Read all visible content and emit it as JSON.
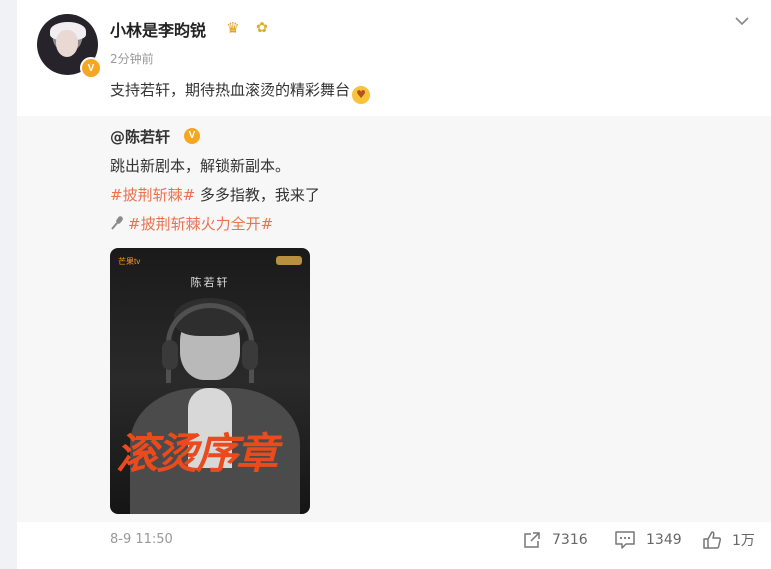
{
  "post": {
    "username": "小林是李昀锐",
    "time": "2分钟前",
    "text": "支持若轩，期待热血滚烫的精彩舞台",
    "emoji": "smiling-face-hearts"
  },
  "repost": {
    "author": "@陈若轩",
    "line1": "跳出新剧本，解锁新副本。",
    "tag1": "#披荆斩棘#",
    "line2_rest": " 多多指教，我来了",
    "tag2": "#披荆斩棘火力全开#",
    "poster": {
      "logo": "芒果tv",
      "name": "陈若轩",
      "title": "滚烫序章"
    },
    "date": "8-9 11:50"
  },
  "actions": {
    "share_count": "7316",
    "comment_count": "1349",
    "like_count": "1万"
  },
  "colors": {
    "accent": "#eb7350",
    "badge": "#f5a623",
    "poster_title": "#ea4a1c"
  }
}
